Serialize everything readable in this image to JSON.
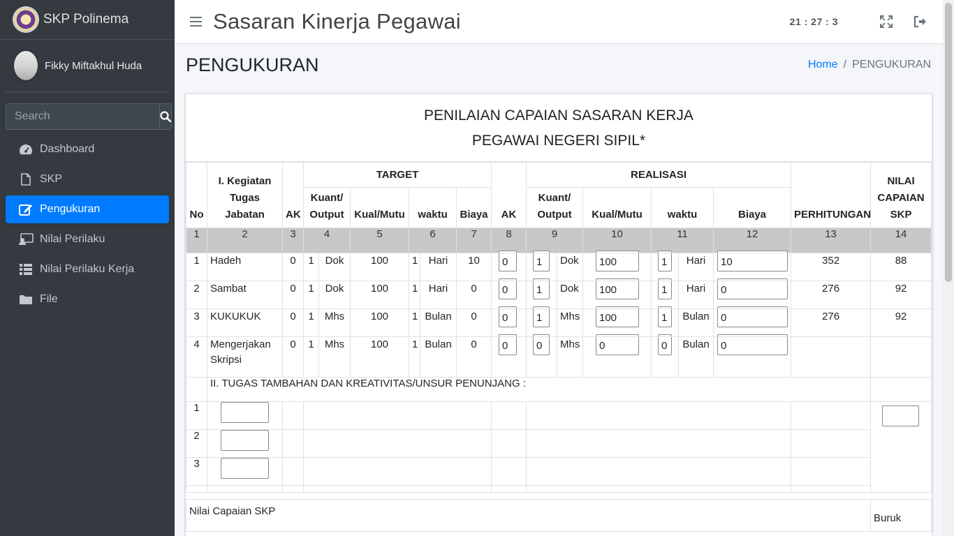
{
  "brand": {
    "name": "SKP Polinema"
  },
  "user": {
    "name": "Fikky Miftakhul Huda"
  },
  "search": {
    "placeholder": "Search"
  },
  "nav": {
    "items": [
      {
        "label": "Dashboard",
        "icon": "dashboard-icon"
      },
      {
        "label": "SKP",
        "icon": "file-icon"
      },
      {
        "label": "Pengukuran",
        "icon": "edit-icon",
        "active": true
      },
      {
        "label": "Nilai Perilaku",
        "icon": "user-card-icon"
      },
      {
        "label": "Nilai Perilaku Kerja",
        "icon": "list-icon"
      },
      {
        "label": "File",
        "icon": "folder-icon"
      }
    ]
  },
  "header": {
    "title": "Sasaran Kinerja Pegawai",
    "clock": "21 : 27 : 3"
  },
  "page": {
    "title": "PENGUKURAN"
  },
  "breadcrumb": {
    "home": "Home",
    "sep": "/",
    "current": "PENGUKURAN"
  },
  "card": {
    "title_line1": "PENILAIAN CAPAIAN SASARAN KERJA",
    "title_line2": "PEGAWAI NEGERI SIPIL*"
  },
  "table": {
    "headers": {
      "no": "No",
      "kegiatan": "I. Kegiatan Tugas Jabatan",
      "ak": "AK",
      "target": "TARGET",
      "realisasi": "REALISASI",
      "kuant": "Kuant/ Output",
      "kual": "Kual/Mutu",
      "waktu": "waktu",
      "biaya": "Biaya",
      "perhitungan": "PERHITUNGAN",
      "nilai": "NILAI CAPAIAN SKP"
    },
    "col_numbers": [
      "1",
      "2",
      "3",
      "4",
      "5",
      "6",
      "7",
      "8",
      "9",
      "10",
      "11",
      "12",
      "13",
      "14"
    ],
    "rows": [
      {
        "no": "1",
        "kegiatan": "Hadeh",
        "ak": "0",
        "t_kuant": "1",
        "t_unit": "Dok",
        "t_kual": "100",
        "t_waktu": "1",
        "t_wunit": "Hari",
        "t_biaya": "10",
        "r_ak": "0",
        "r_kuant": "1",
        "r_unit": "Dok",
        "r_kual": "100",
        "r_waktu": "1",
        "r_wunit": "Hari",
        "r_biaya": "10",
        "perhitungan": "352",
        "nilai": "88"
      },
      {
        "no": "2",
        "kegiatan": "Sambat",
        "ak": "0",
        "t_kuant": "1",
        "t_unit": "Dok",
        "t_kual": "100",
        "t_waktu": "1",
        "t_wunit": "Hari",
        "t_biaya": "0",
        "r_ak": "0",
        "r_kuant": "1",
        "r_unit": "Dok",
        "r_kual": "100",
        "r_waktu": "1",
        "r_wunit": "Hari",
        "r_biaya": "0",
        "perhitungan": "276",
        "nilai": "92"
      },
      {
        "no": "3",
        "kegiatan": "KUKUKUK",
        "ak": "0",
        "t_kuant": "1",
        "t_unit": "Mhs",
        "t_kual": "100",
        "t_waktu": "1",
        "t_wunit": "Bulan",
        "t_biaya": "0",
        "r_ak": "0",
        "r_kuant": "1",
        "r_unit": "Mhs",
        "r_kual": "100",
        "r_waktu": "1",
        "r_wunit": "Bulan",
        "r_biaya": "0",
        "perhitungan": "276",
        "nilai": "92"
      },
      {
        "no": "4",
        "kegiatan": "Mengerjakan Skripsi",
        "ak": "0",
        "t_kuant": "1",
        "t_unit": "Mhs",
        "t_kual": "100",
        "t_waktu": "1",
        "t_wunit": "Bulan",
        "t_biaya": "0",
        "r_ak": "0",
        "r_kuant": "0",
        "r_unit": "Mhs",
        "r_kual": "0",
        "r_waktu": "0",
        "r_wunit": "Bulan",
        "r_biaya": "0",
        "perhitungan": "",
        "nilai": ""
      }
    ],
    "section2_label": "II. TUGAS TAMBAHAN DAN KREATIVITAS/UNSUR PENUNJANG :",
    "tambahan_rows": [
      "1",
      "2",
      "3"
    ],
    "footer": {
      "label": "Nilai Capaian SKP",
      "value": "Buruk"
    }
  },
  "colors": {
    "sidebar": "#343a40",
    "active": "#007bff",
    "header_row": "#c8c8c8"
  }
}
